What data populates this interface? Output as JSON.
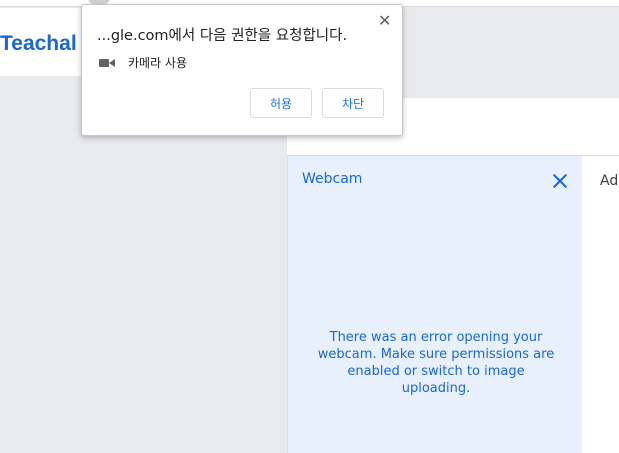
{
  "app": {
    "brand": "Teachal"
  },
  "permission_dialog": {
    "title": "...gle.com에서 다음 권한을 요청합니다.",
    "close_glyph": "✕",
    "permission_label": "카메라 사용",
    "permission_icon": "camera-icon",
    "allow_label": "허용",
    "block_label": "차단"
  },
  "webcam_panel": {
    "title": "Webcam",
    "error_message": "There was an error opening your webcam. Make sure permissions are enabled or switch to image uploading."
  },
  "right_panel": {
    "label": "Ad"
  },
  "colors": {
    "accent": "#1967d2",
    "panel_background": "#e8f0fe",
    "page_background": "#e8eaed"
  }
}
